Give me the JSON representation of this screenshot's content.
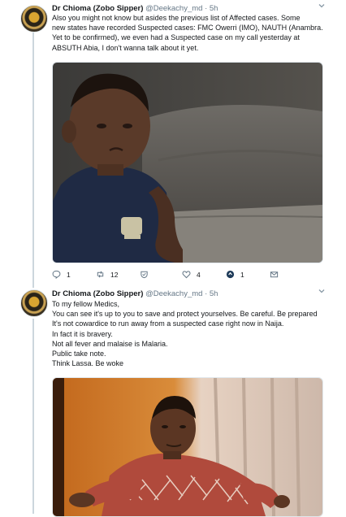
{
  "tweets": [
    {
      "author": "Dr Chioma (Zobo Sipper)",
      "handle": "@Deekachy_md",
      "time": "5h",
      "text_lines": [
        "Also you might not know but asides the previous list of  Affected cases. Some",
        "new states have recorded Suspected cases: FMC Owerri (IMO), NAUTH (Anambra.",
        "Yet to be confirmed),  we even had a Suspected case on my call yesterday at",
        "ABSUTH Abia, I don't wanna talk about it yet."
      ],
      "actions": {
        "replies": "1",
        "retweets": "12",
        "likes": "4",
        "reply_count_extra": "1"
      }
    },
    {
      "author": "Dr Chioma (Zobo Sipper)",
      "handle": "@Deekachy_md",
      "time": "5h",
      "text_lines": [
        "To my fellow Medics,",
        "You can see it's up to you to save and protect yourselves. Be careful. Be prepared",
        "It's not cowardice to run away from a suspected case right now in Naija.",
        "In fact it is bravery.",
        "Not all fever and malaise is Malaria.",
        "Public take note.",
        "Think Lassa. Be woke"
      ]
    }
  ],
  "colors": {
    "text": "#14171a",
    "secondary": "#657786",
    "thread_line": "#ccd6dd",
    "twitter_blue": "#1da1f2"
  }
}
